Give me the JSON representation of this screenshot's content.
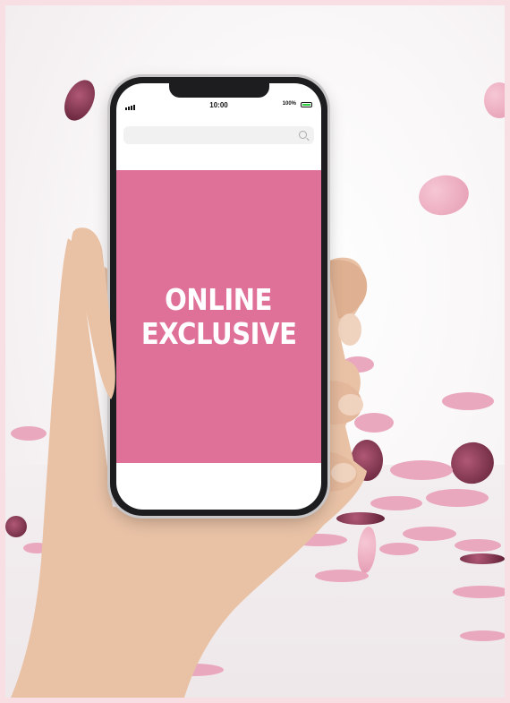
{
  "phone": {
    "status": {
      "time": "10:00",
      "battery": "100%"
    },
    "banner": {
      "line1": "ONLINE",
      "line2": "EXCLUSIVE"
    },
    "colors": {
      "banner": "#df7098",
      "border": "#f7dfe3",
      "confetti": "#e9a8bd"
    }
  },
  "icons": [
    "signal-icon",
    "battery-icon",
    "search-icon"
  ]
}
